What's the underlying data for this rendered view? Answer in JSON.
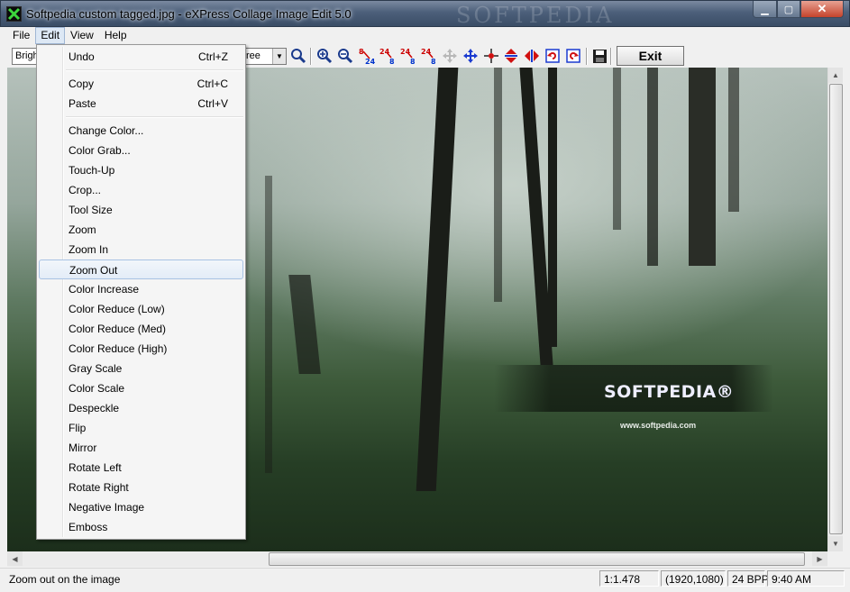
{
  "window": {
    "title": "Softpedia custom tagged.jpg - eXPress Collage Image Edit 5.0",
    "watermark": "SOFTPEDIA",
    "min_symbol": "▁",
    "max_symbol": "▢",
    "close_symbol": "✕"
  },
  "menubar": {
    "items": [
      {
        "label": "File"
      },
      {
        "label": "Edit"
      },
      {
        "label": "View"
      },
      {
        "label": "Help"
      }
    ]
  },
  "toolbar": {
    "filter_input_value": "Brigh",
    "select_value": "ree",
    "exit_label": "Exit",
    "icons": [
      "zoom-icon",
      "zoom-in-icon",
      "zoom-out-icon",
      "8-to-24-bit-icon",
      "24-to-8-bit-icon",
      "24-to-8-bit-b-icon",
      "24-to-8-bit-c-icon",
      "move-disabled-icon",
      "move-icon",
      "crosshair-icon",
      "flip-vertical-icon",
      "mirror-icon",
      "rotate-left-icon",
      "rotate-right-icon",
      "save-icon"
    ]
  },
  "edit_menu": {
    "items": [
      {
        "label": "Undo",
        "shortcut": "Ctrl+Z"
      },
      {
        "label": "Copy",
        "shortcut": "Ctrl+C"
      },
      {
        "label": "Paste",
        "shortcut": "Ctrl+V"
      },
      {
        "label": "Change Color..."
      },
      {
        "label": "Color Grab..."
      },
      {
        "label": "Touch-Up"
      },
      {
        "label": "Crop..."
      },
      {
        "label": "Tool Size"
      },
      {
        "label": "Zoom"
      },
      {
        "label": "Zoom In"
      },
      {
        "label": "Zoom Out"
      },
      {
        "label": "Color Increase"
      },
      {
        "label": "Color Reduce (Low)"
      },
      {
        "label": "Color Reduce (Med)"
      },
      {
        "label": "Color Reduce (High)"
      },
      {
        "label": "Gray Scale"
      },
      {
        "label": "Color Scale"
      },
      {
        "label": "Despeckle"
      },
      {
        "label": "Flip"
      },
      {
        "label": "Mirror"
      },
      {
        "label": "Rotate Left"
      },
      {
        "label": "Rotate Right"
      },
      {
        "label": "Negative Image"
      },
      {
        "label": "Emboss"
      }
    ],
    "highlighted": "Zoom Out"
  },
  "image": {
    "watermark_logo": "SOFTPEDIA®",
    "watermark_url": "www.softpedia.com"
  },
  "statusbar": {
    "message": "Zoom out on the image",
    "zoom": "1:1.478",
    "dimensions": "(1920,1080)",
    "bpp": "24 BPP",
    "time": "9:40 AM"
  },
  "colors": {
    "title_bar": "#4c5f7a",
    "close_button": "#c4432b",
    "menu_highlight": "#dde8f5"
  }
}
